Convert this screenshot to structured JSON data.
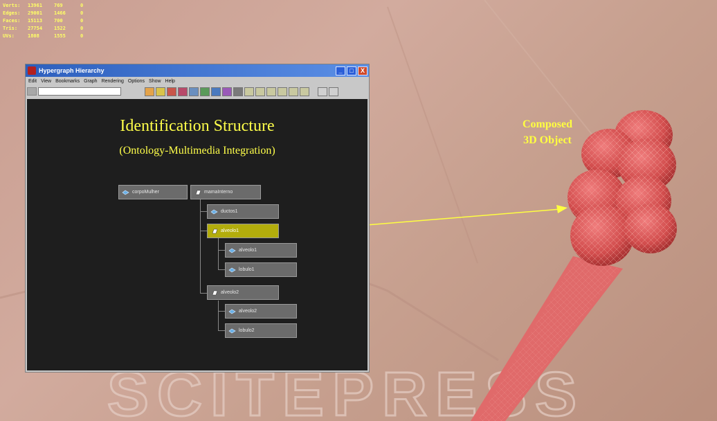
{
  "stats": {
    "rows": [
      {
        "label": "Verts:",
        "v1": "13961",
        "v2": "769",
        "v3": "0"
      },
      {
        "label": "Edges:",
        "v1": "29001",
        "v2": "1466",
        "v3": "0"
      },
      {
        "label": "Faces:",
        "v1": "15113",
        "v2": "700",
        "v3": "0"
      },
      {
        "label": "Tris:",
        "v1": "27754",
        "v2": "1522",
        "v3": "0"
      },
      {
        "label": "UVs:",
        "v1": "1808",
        "v2": "1555",
        "v3": "0"
      }
    ]
  },
  "window": {
    "title": "Hypergraph Hierarchy",
    "controls": {
      "minimize": "_",
      "maximize": "□",
      "close": "X"
    },
    "menu": [
      "Edit",
      "View",
      "Bookmarks",
      "Graph",
      "Rendering",
      "Options",
      "Show",
      "Help"
    ]
  },
  "canvas": {
    "title": "Identification Structure",
    "subtitle": "(Ontology-Multimedia Integration)",
    "nodes": [
      {
        "label": "corpoMulher"
      },
      {
        "label": "mamaInterno"
      },
      {
        "label": "ductos1"
      },
      {
        "label": "alveolo1"
      },
      {
        "label": "alveolo1"
      },
      {
        "label": "lobulo1"
      },
      {
        "label": "alveolo2"
      },
      {
        "label": "alveolo2"
      },
      {
        "label": "lobulo2"
      }
    ]
  },
  "annotation": {
    "line1": "Composed",
    "line2": "3D Object"
  },
  "watermark": "SCITEPRESS",
  "colors": {
    "accent": "#ffff4a",
    "selected": "#b3ad0c",
    "canvas": "#1e1e1e"
  }
}
